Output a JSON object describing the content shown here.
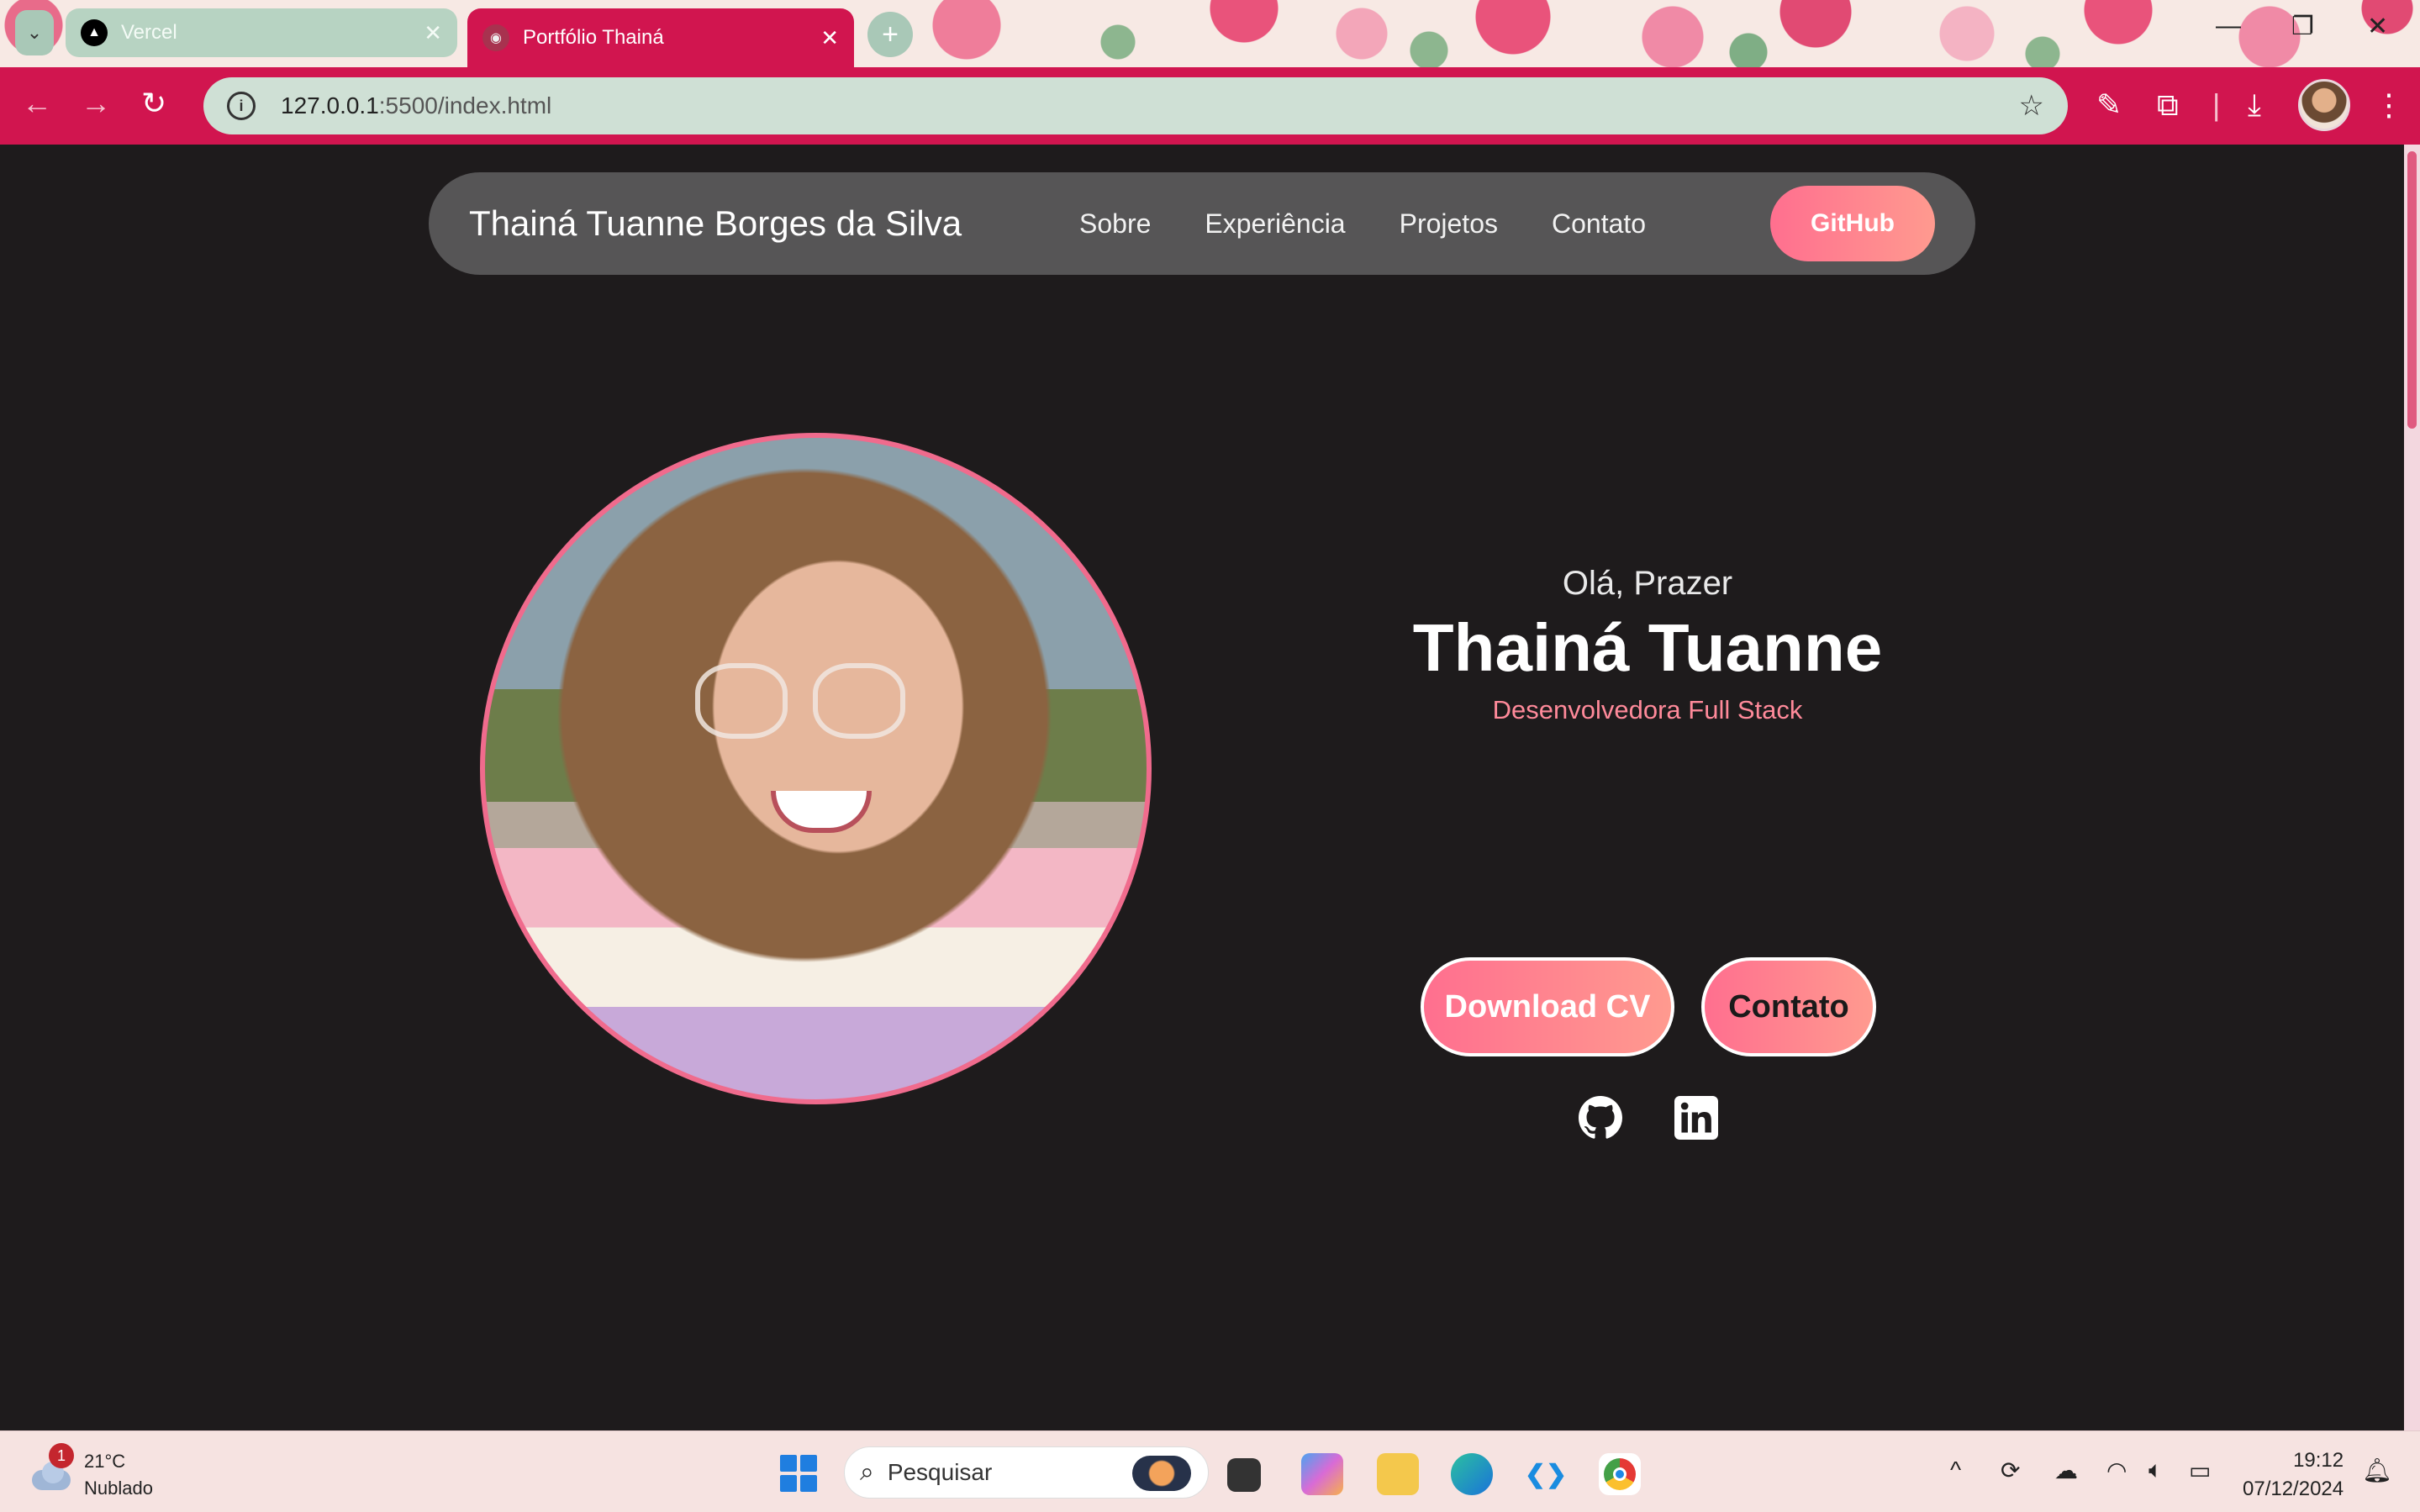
{
  "browser": {
    "tabs": [
      {
        "title": "Vercel",
        "active": false
      },
      {
        "title": "Portfólio Thainá",
        "active": true
      }
    ],
    "url_host": "127.0.0.1",
    "url_path": ":5500/index.html"
  },
  "nav": {
    "brand": "Thainá Tuanne Borges da Silva",
    "links": [
      "Sobre",
      "Experiência",
      "Projetos",
      "Contato"
    ],
    "github_label": "GitHub"
  },
  "hero": {
    "greeting": "Olá, Prazer",
    "name": "Thainá Tuanne",
    "role": "Desenvolvedora Full Stack",
    "download_label": "Download CV",
    "contact_label": "Contato",
    "socials": [
      "github-icon",
      "linkedin-icon"
    ]
  },
  "taskbar": {
    "weather_badge": "1",
    "temperature": "21°C",
    "condition": "Nublado",
    "search_placeholder": "Pesquisar",
    "time": "19:12",
    "date": "07/12/2024"
  },
  "colors": {
    "accent": "#d1154f",
    "button_gradient_start": "#ff6f8f",
    "button_gradient_end": "#ff9a8f",
    "role_text": "#ff8a9a",
    "page_bg": "#1e1b1c"
  }
}
